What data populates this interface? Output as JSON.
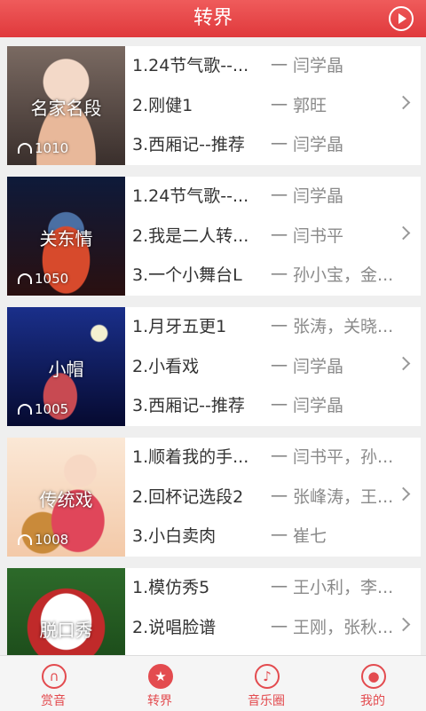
{
  "header": {
    "title": "转界"
  },
  "cards": [
    {
      "category": "名家名段",
      "plays": "1010",
      "songs": [
        {
          "name": "1.24节气歌--...",
          "artist": "一 闫学晶"
        },
        {
          "name": "2.刚健1",
          "artist": "一 郭旺"
        },
        {
          "name": "3.西厢记--推荐",
          "artist": "一 闫学晶"
        }
      ]
    },
    {
      "category": "关东情",
      "plays": "1050",
      "songs": [
        {
          "name": "1.24节气歌--...",
          "artist": "一 闫学晶"
        },
        {
          "name": "2.我是二人转...",
          "artist": "一 闫书平"
        },
        {
          "name": "3.一个小舞台L",
          "artist": "一 孙小宝，金..."
        }
      ]
    },
    {
      "category": "小帽",
      "plays": "1005",
      "songs": [
        {
          "name": "1.月牙五更1",
          "artist": "一 张涛，关晓..."
        },
        {
          "name": "2.小看戏",
          "artist": "一 闫学晶"
        },
        {
          "name": "3.西厢记--推荐",
          "artist": "一 闫学晶"
        }
      ]
    },
    {
      "category": "传统戏",
      "plays": "1008",
      "songs": [
        {
          "name": "1.顺着我的手...",
          "artist": "一 闫书平，孙..."
        },
        {
          "name": "2.回杯记选段2",
          "artist": "一 张峰涛，王..."
        },
        {
          "name": "3.小白卖肉",
          "artist": "一 崔七"
        }
      ]
    },
    {
      "category": "脱口秀",
      "plays": "",
      "songs": [
        {
          "name": "1.模仿秀5",
          "artist": "一 王小利，李..."
        },
        {
          "name": "2.说唱脸谱",
          "artist": "一 王刚，张秋..."
        }
      ]
    }
  ],
  "tabs": [
    {
      "label": "赏音",
      "icon": "headphones-icon"
    },
    {
      "label": "转界",
      "icon": "dancer-icon"
    },
    {
      "label": "音乐圈",
      "icon": "music-note-icon"
    },
    {
      "label": "我的",
      "icon": "user-icon"
    }
  ],
  "colors": {
    "accent": "#e34b4f",
    "header_top": "#ef5b5b",
    "header_bottom": "#e0393c"
  }
}
